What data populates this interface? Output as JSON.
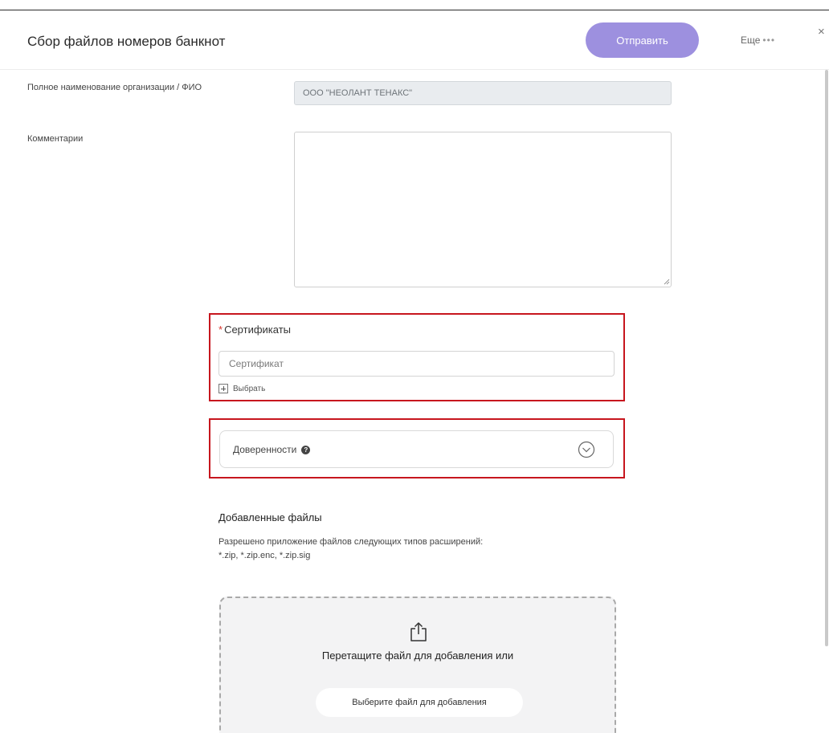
{
  "header": {
    "title": "Сбор файлов номеров банкнот",
    "send_label": "Отправить",
    "more_label": "Еще",
    "more_dots": "•••",
    "close_glyph": "×"
  },
  "form": {
    "org_label": "Полное наименование организации / ФИО",
    "org_value": "ООО \"НЕОЛАНТ ТЕНАКС\"",
    "comments_label": "Комментарии",
    "comments_value": ""
  },
  "certificates": {
    "required_mark": "*",
    "title": "Сертификаты",
    "placeholder": "Сертификат",
    "choose_label": "Выбрать"
  },
  "power_of_attorney": {
    "label": "Доверенности",
    "help_glyph": "?"
  },
  "files": {
    "title": "Добавленные файлы",
    "desc_line1": "Разрешено приложение файлов следующих типов расширений:",
    "desc_line2": "*.zip, *.zip.enc, *.zip.sig",
    "drop_text": "Перетащите файл для добавления или",
    "choose_file_label": "Выберите файл для добавления"
  },
  "icons": {
    "close": "close-icon",
    "upload": "upload-icon",
    "expand": "chevron-down-circle-icon",
    "help": "question-circle-icon",
    "plus": "plus-square-icon"
  },
  "colors": {
    "accent": "#9d90df",
    "highlight": "#c7161e",
    "required": "#d9342b"
  }
}
